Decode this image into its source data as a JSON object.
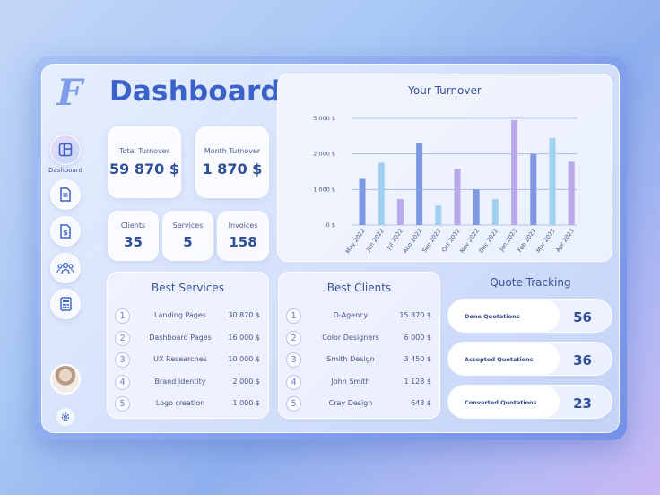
{
  "app": {
    "logo_letter": "F",
    "title": "Dashboard"
  },
  "sidebar": {
    "items": [
      {
        "icon": "layout-icon",
        "label": "Dashboard",
        "active": true
      },
      {
        "icon": "document-icon"
      },
      {
        "icon": "invoice-icon"
      },
      {
        "icon": "users-icon"
      },
      {
        "icon": "calculator-icon"
      }
    ]
  },
  "stats": {
    "total_turnover": {
      "label": "Total Turnover",
      "value": "59 870 $"
    },
    "month_turnover": {
      "label": "Month Turnover",
      "value": "1 870 $"
    },
    "clients": {
      "label": "Clients",
      "value": "35"
    },
    "services": {
      "label": "Services",
      "value": "5"
    },
    "invoices": {
      "label": "Invoices",
      "value": "158"
    }
  },
  "chart_data": {
    "type": "bar",
    "title": "Your Turnover",
    "categories": [
      "May 2022",
      "Jun 2022",
      "Jul 2022",
      "Aug 2022",
      "Sep 2022",
      "Oct 2022",
      "Nov 2022",
      "Dec 2022",
      "Jan 2023",
      "Feb 2023",
      "Mar 2023",
      "Apr 2023"
    ],
    "ytick_labels": [
      "0 $",
      "1 000 $",
      "2 000 $",
      "3 000 $"
    ],
    "ylim": [
      0,
      3000
    ],
    "grid": true,
    "bars": [
      {
        "values": [
          1300,
          2300,
          1000,
          2000
        ],
        "color": "#7f98e2"
      },
      {
        "values": [
          1750,
          550,
          550,
          2450
        ],
        "color": "#9fd0f0"
      },
      {
        "values": [
          730,
          1580,
          2950,
          1780
        ],
        "color": "#b9a8ea"
      }
    ],
    "values": [
      1300,
      1750,
      730,
      2300,
      550,
      1580,
      1000,
      730,
      2950,
      2000,
      2450,
      1780
    ],
    "colors": [
      "#7f98e2",
      "#9fd0f0",
      "#b9a8ea",
      "#7f98e2",
      "#9fd0f0",
      "#b9a8ea",
      "#7f98e2",
      "#9fd0f0",
      "#b9a8ea",
      "#7f98e2",
      "#9fd0f0",
      "#b9a8ea"
    ]
  },
  "best_services": {
    "title": "Best Services",
    "rows": [
      {
        "n": "1",
        "name": "Landing Pages",
        "value": "30 870 $"
      },
      {
        "n": "2",
        "name": "Dashboard Pages",
        "value": "16 000 $"
      },
      {
        "n": "3",
        "name": "UX Researches",
        "value": "10 000 $"
      },
      {
        "n": "4",
        "name": "Brand Identity",
        "value": "2 000 $"
      },
      {
        "n": "5",
        "name": "Logo creation",
        "value": "1 000 $"
      }
    ]
  },
  "best_clients": {
    "title": "Best Clients",
    "rows": [
      {
        "n": "1",
        "name": "D-Agency",
        "value": "15 870 $"
      },
      {
        "n": "2",
        "name": "Color Designers",
        "value": "6 000 $"
      },
      {
        "n": "3",
        "name": "Smith Design",
        "value": "3 450 $"
      },
      {
        "n": "4",
        "name": "John Smith",
        "value": "1 128 $"
      },
      {
        "n": "5",
        "name": "Cray Design",
        "value": "648 $"
      }
    ]
  },
  "quote_tracking": {
    "title": "Quote Tracking",
    "items": [
      {
        "label": "Done Quotations",
        "value": "56"
      },
      {
        "label": "Accepted Quotations",
        "value": "36"
      },
      {
        "label": "Converted Quotations",
        "value": "23"
      }
    ]
  }
}
